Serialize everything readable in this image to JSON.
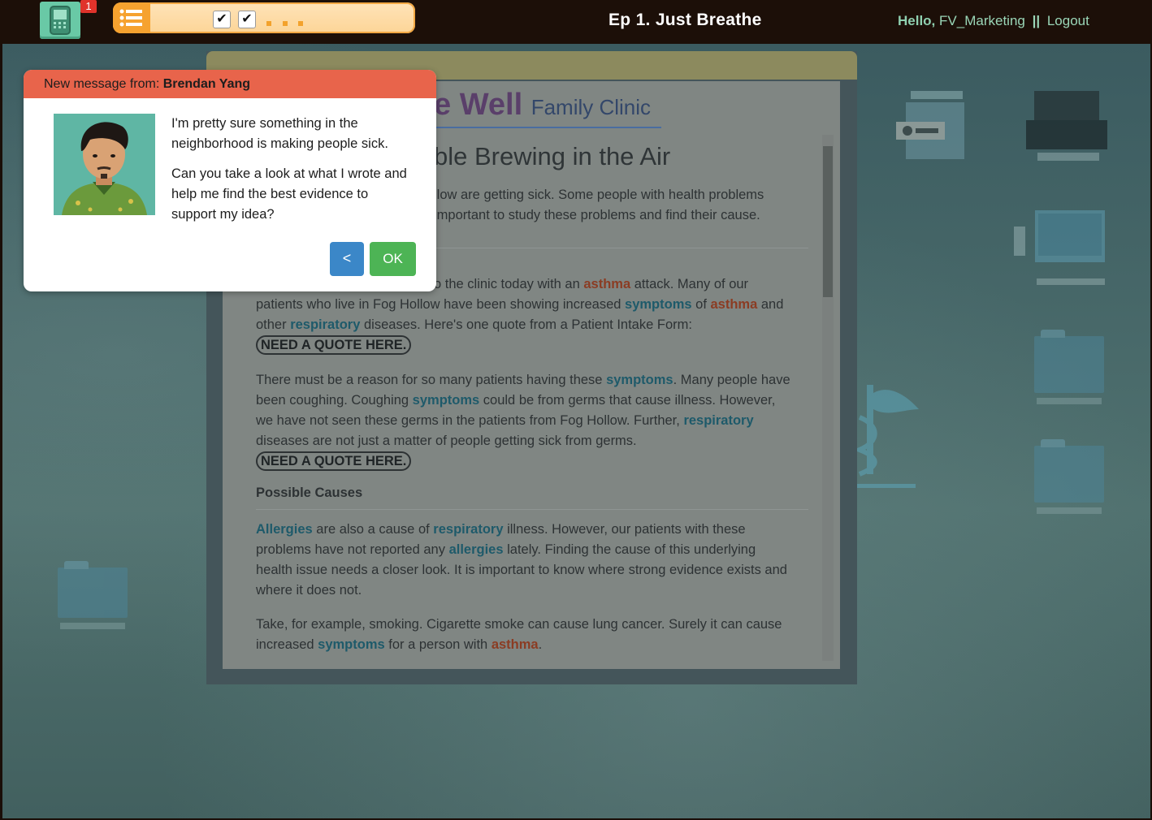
{
  "topbar": {
    "notification_count": "1",
    "progress": {
      "completed": 2,
      "remaining": 3
    },
    "episode_title": "Ep 1. Just Breathe",
    "greeting": "Hello,",
    "username": "FV_Marketing",
    "separator": "||",
    "logout_label": "Logout",
    "check_glyph": "✔"
  },
  "document": {
    "clinic_name": "e Well",
    "clinic_name_suffix": "Family Clinic",
    "heading": "ble Brewing in the Air",
    "intro": "llow are getting sick. Some people with health problems",
    "intro2": "important to study these problems and find their cause.",
    "p1_part1": "o the clinic today with an ",
    "p1_part2": " attack. Many of our patients who live in Fog Hollow have been showing increased ",
    "p1_part3": " of ",
    "p1_part4": " and other ",
    "p1_part5": " diseases. Here's one quote from a Patient Intake Form: ",
    "p2_part1": "There must be a reason for so many patients having these ",
    "p2_part2": ". Many people have been coughing. Coughing ",
    "p2_part3": " could be from germs that cause illness. However, we have not seen these germs in the patients from Fog Hollow. Further, ",
    "p2_part4": " diseases are not just a matter of people getting sick from germs. ",
    "subheading": "Possible Causes",
    "p3_part1": " are also a cause of ",
    "p3_part2": " illness. However, our patients with these problems have not reported any ",
    "p3_part3": " lately. Finding the cause of this underlying health issue needs a closer look. It is important to know where strong evidence exists and where it does not.",
    "p4_part1": "Take, for example, smoking. Cigarette smoke can cause lung cancer. Surely it can cause increased ",
    "p4_part2": " for a person with ",
    "p4_part3": ".",
    "term_asthma": "asthma",
    "term_symptoms": "symptoms",
    "term_respiratory": "respiratory",
    "term_allergies_cap": "Allergies",
    "term_allergies": "allergies",
    "quote_placeholder": "NEED A QUOTE HERE."
  },
  "dialog": {
    "header_prefix": "New message from: ",
    "sender": "Brendan Yang",
    "message1": "I'm pretty sure something in the neighborhood is making people sick.",
    "message2": "Can you take a look at what I wrote and help me find the best evidence to support my idea?",
    "back_label": "<",
    "ok_label": "OK"
  },
  "colors": {
    "accent_header": "#e8644b",
    "ok_button": "#4db455",
    "back_button": "#3b87c8",
    "topbar_bg": "#1c0f08"
  }
}
